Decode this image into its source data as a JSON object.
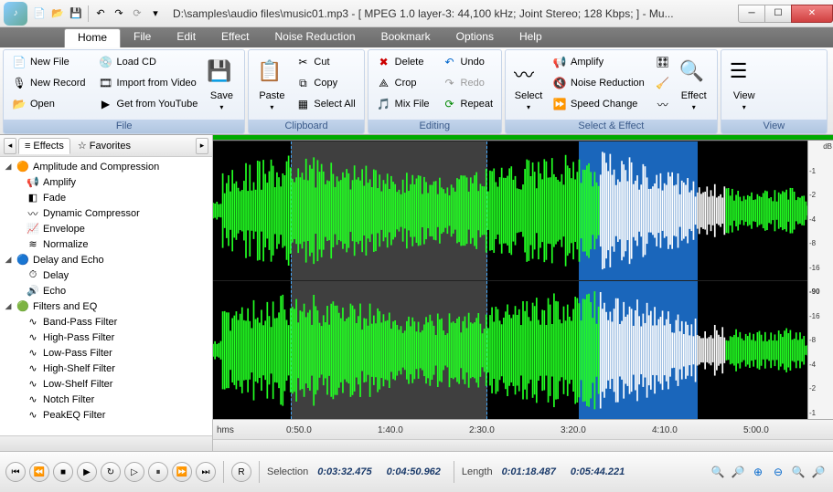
{
  "titlebar": {
    "title": "D:\\samples\\audio files\\music01.mp3 - [ MPEG 1.0 layer-3: 44,100 kHz; Joint Stereo; 128 Kbps;  ] - Mu..."
  },
  "menu": {
    "tabs": [
      "Home",
      "File",
      "Edit",
      "Effect",
      "Noise Reduction",
      "Bookmark",
      "Options",
      "Help"
    ],
    "active": 0
  },
  "ribbon": {
    "file": {
      "label": "File",
      "new_file": "New File",
      "new_record": "New Record",
      "open": "Open",
      "load_cd": "Load CD",
      "import_video": "Import from Video",
      "get_youtube": "Get from YouTube",
      "save": "Save"
    },
    "clipboard": {
      "label": "Clipboard",
      "paste": "Paste",
      "cut": "Cut",
      "copy": "Copy",
      "select_all": "Select All"
    },
    "editing": {
      "label": "Editing",
      "delete": "Delete",
      "crop": "Crop",
      "mix_file": "Mix File",
      "undo": "Undo",
      "redo": "Redo",
      "repeat": "Repeat"
    },
    "select_effect": {
      "label": "Select & Effect",
      "select": "Select",
      "amplify": "Amplify",
      "noise_reduction": "Noise Reduction",
      "speed_change": "Speed Change",
      "effect": "Effect"
    },
    "view": {
      "label": "View",
      "view": "View"
    }
  },
  "sidebar": {
    "tabs": {
      "effects": "Effects",
      "favorites": "Favorites"
    },
    "groups": [
      {
        "label": "Amplitude and Compression",
        "items": [
          "Amplify",
          "Fade",
          "Dynamic Compressor",
          "Envelope",
          "Normalize"
        ]
      },
      {
        "label": "Delay and Echo",
        "items": [
          "Delay",
          "Echo"
        ]
      },
      {
        "label": "Filters and EQ",
        "items": [
          "Band-Pass Filter",
          "High-Pass Filter",
          "Low-Pass Filter",
          "High-Shelf Filter",
          "Low-Shelf Filter",
          "Notch Filter",
          "PeakEQ Filter"
        ]
      }
    ]
  },
  "waveform": {
    "db_label": "dB",
    "db_scale": [
      "-1",
      "-2",
      "-4",
      "-8",
      "-16",
      "-90",
      "-16",
      "-8",
      "-4",
      "-2",
      "-1"
    ],
    "ruler_unit": "hms",
    "ruler": [
      "0:50.0",
      "1:40.0",
      "2:30.0",
      "3:20.0",
      "4:10.0",
      "5:00.0"
    ]
  },
  "bottom": {
    "rec": "R",
    "selection_label": "Selection",
    "sel_start": "0:03:32.475",
    "sel_end": "0:04:50.962",
    "length_label": "Length",
    "len_sel": "0:01:18.487",
    "len_total": "0:05:44.221"
  }
}
